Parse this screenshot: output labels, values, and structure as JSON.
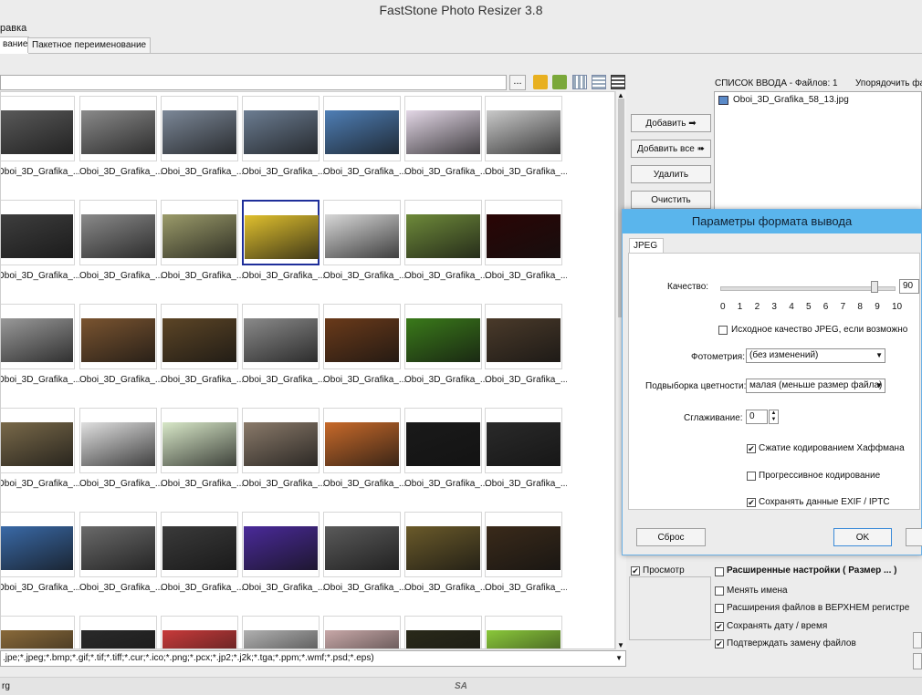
{
  "window": {
    "title": "FastStone Photo Resizer 3.8"
  },
  "menu": {
    "item_partial": "равка"
  },
  "tabs": [
    {
      "label": "вание"
    },
    {
      "label": "Пакетное переименование"
    }
  ],
  "path_browse_label": "...",
  "thumbnails": [
    [
      {
        "name": "Oboi_3D_Grafika_...",
        "color": "#5a5a5a"
      },
      {
        "name": "Oboi_3D_Grafika_...",
        "color": "#8a8a8a"
      },
      {
        "name": "Oboi_3D_Grafika_...",
        "color": "#7c8898"
      },
      {
        "name": "Oboi_3D_Grafika_...",
        "color": "#6c7d92"
      },
      {
        "name": "Oboi_3D_Grafika_...",
        "color": "#4f7fb6"
      },
      {
        "name": "Oboi_3D_Grafika_...",
        "color": "#e3d7e6"
      },
      {
        "name": "Oboi_3D_Grafika_...",
        "color": "#c9c9c9"
      }
    ],
    [
      {
        "name": "Oboi_3D_Grafika_...",
        "color": "#3e3e3e"
      },
      {
        "name": "Oboi_3D_Grafika_...",
        "color": "#8a8a8a"
      },
      {
        "name": "Oboi_3D_Grafika_...",
        "color": "#9b9b6a"
      },
      {
        "name": "Oboi_3D_Grafika_...",
        "color": "#e0c02e"
      },
      {
        "name": "Oboi_3D_Grafika_...",
        "color": "#d8d8d8"
      },
      {
        "name": "Oboi_3D_Grafika_...",
        "color": "#6e8a3a"
      },
      {
        "name": "Oboi_3D_Grafika_...",
        "color": "#2a0505"
      }
    ],
    [
      {
        "name": "Oboi_3D_Grafika_...",
        "color": "#9a9a9a"
      },
      {
        "name": "Oboi_3D_Grafika_...",
        "color": "#7a5430"
      },
      {
        "name": "Oboi_3D_Grafika_...",
        "color": "#5c4526"
      },
      {
        "name": "Oboi_3D_Grafika_...",
        "color": "#8a8a8a"
      },
      {
        "name": "Oboi_3D_Grafika_...",
        "color": "#6a3a1a"
      },
      {
        "name": "Oboi_3D_Grafika_...",
        "color": "#3a7a1a"
      },
      {
        "name": "Oboi_3D_Grafika_...",
        "color": "#4a3a2a"
      }
    ],
    [
      {
        "name": "Oboi_3D_Grafika_...",
        "color": "#7a6a4a"
      },
      {
        "name": "Oboi_3D_Grafika_...",
        "color": "#e0e0e0"
      },
      {
        "name": "Oboi_3D_Grafika_...",
        "color": "#d8e8c8"
      },
      {
        "name": "Oboi_3D_Grafika_...",
        "color": "#8a7a6a"
      },
      {
        "name": "Oboi_3D_Grafika_...",
        "color": "#c86a2a"
      },
      {
        "name": "Oboi_3D_Grafika_...",
        "color": "#1a1a1a"
      },
      {
        "name": "Oboi_3D_Grafika_...",
        "color": "#2a2a2a"
      }
    ],
    [
      {
        "name": "Oboi_3D_Grafika_...",
        "color": "#3a6aa8"
      },
      {
        "name": "Oboi_3D_Grafika_...",
        "color": "#6a6a6a"
      },
      {
        "name": "Oboi_3D_Grafika_...",
        "color": "#3a3a3a"
      },
      {
        "name": "Oboi_3D_Grafika_...",
        "color": "#4a2a9a"
      },
      {
        "name": "Oboi_3D_Grafika_...",
        "color": "#5a5a5a"
      },
      {
        "name": "Oboi_3D_Grafika_...",
        "color": "#6a5a2a"
      },
      {
        "name": "Oboi_3D_Grafika_...",
        "color": "#3a2a1a"
      }
    ],
    [
      {
        "name": "",
        "color": "#8a6a3a"
      },
      {
        "name": "",
        "color": "#2a2a2a"
      },
      {
        "name": "",
        "color": "#c83a3a"
      },
      {
        "name": "",
        "color": "#b0b0b0"
      },
      {
        "name": "",
        "color": "#c8a8a8"
      },
      {
        "name": "",
        "color": "#2a2a1a"
      },
      {
        "name": "",
        "color": "#8ac83a"
      }
    ]
  ],
  "filter": {
    "value": ".jpe;*.jpeg;*.bmp;*.gif;*.tif;*.tiff;*.cur;*.ico;*.png;*.pcx;*.jp2;*.j2k;*.tga;*.ppm;*.wmf;*.psd;*.eps)"
  },
  "status": {
    "left": "rg",
    "mid": "SA"
  },
  "actions": {
    "add": "Добавить",
    "add_all": "Добавить все",
    "remove": "Удалить",
    "clear": "Очистить"
  },
  "input_list": {
    "header": "СПИСОК ВВОДА  -  Файлов: 1",
    "sort": "Упорядочить файл",
    "files": [
      "Oboi_3D_Grafika_58_13.jpg"
    ]
  },
  "dialog": {
    "title": "Параметры формата вывода",
    "tab": "JPEG",
    "quality_label": "Качество:",
    "quality_value": "90",
    "quality_level": 90,
    "scale": [
      "0",
      "1",
      "2",
      "3",
      "4",
      "5",
      "6",
      "7",
      "8",
      "9",
      "10"
    ],
    "original_quality": "Исходное качество JPEG, если возможно",
    "photometry_label": "Фотометрия:",
    "photometry_value": "(без изменений)",
    "subsampling_label": "Подвыборка цветности:",
    "subsampling_value": "малая (меньше размер файла)",
    "smoothing_label": "Сглаживание:",
    "smoothing_value": "0",
    "huffman": "Сжатие кодированием Хаффмана",
    "huffman_checked": true,
    "progressive": "Прогрессивное кодирование",
    "progressive_checked": false,
    "exif": "Сохранять данные EXIF / IPTC",
    "exif_checked": true,
    "reset": "Сброс",
    "ok": "OK",
    "check_mark": "✔"
  },
  "bottom": {
    "preview": "Просмотр",
    "advanced": "Расширенные настройки ( Размер ... )",
    "rename": "Менять имена",
    "upper_ext": "Расширения файлов в ВЕРХНЕМ регистре",
    "keep_date": "Сохранять дату / время",
    "confirm_replace": "Подтверждать замену файлов"
  }
}
